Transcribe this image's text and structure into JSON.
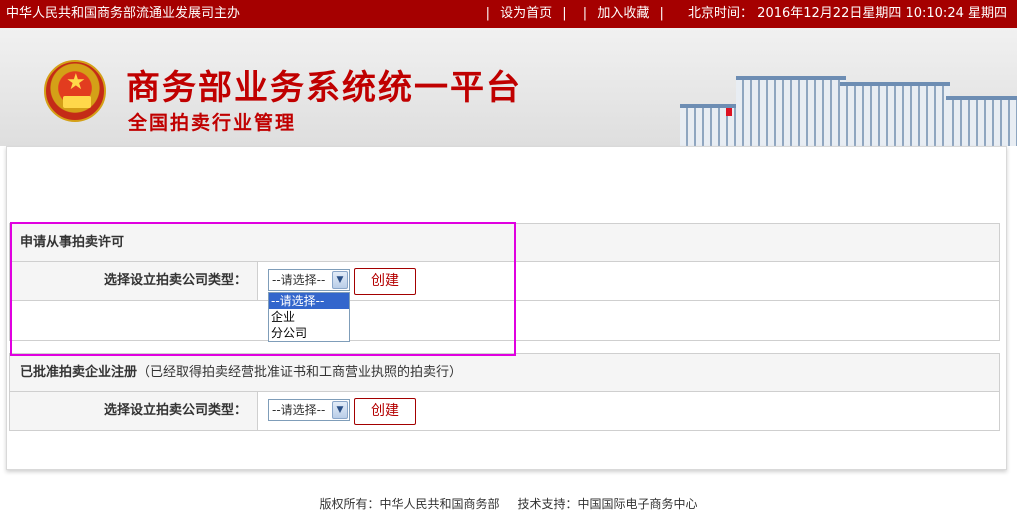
{
  "topbar": {
    "sponsor": "中华人民共和国商务部流通业发展司主办",
    "set_home": "设为首页",
    "add_favorite": "加入收藏",
    "clock_label": "北京时间：",
    "clock_value": "2016年12月22日星期四 10:10:24 星期四"
  },
  "banner": {
    "title": "商务部业务系统统一平台",
    "subtitle": "全国拍卖行业管理"
  },
  "section_apply": {
    "heading": "申请从事拍卖许可",
    "field_label": "选择设立拍卖公司类型：",
    "select_value": "--请选择--",
    "options": [
      "--请选择--",
      "企业",
      "分公司"
    ],
    "button": "创建"
  },
  "section_registered": {
    "heading": "已批准拍卖企业注册",
    "heading_note": "（已经取得拍卖经营批准证书和工商营业执照的拍卖行）",
    "field_label": "选择设立拍卖公司类型：",
    "select_value": "--请选择--",
    "button": "创建"
  },
  "footer": {
    "copyright": "版权所有：中华人民共和国商务部",
    "support": "技术支持：中国国际电子商务中心"
  },
  "colors": {
    "topbar_bg": "#a50000",
    "title_red": "#c00000",
    "highlight": "#e000e0",
    "option_selected": "#3366cc"
  }
}
